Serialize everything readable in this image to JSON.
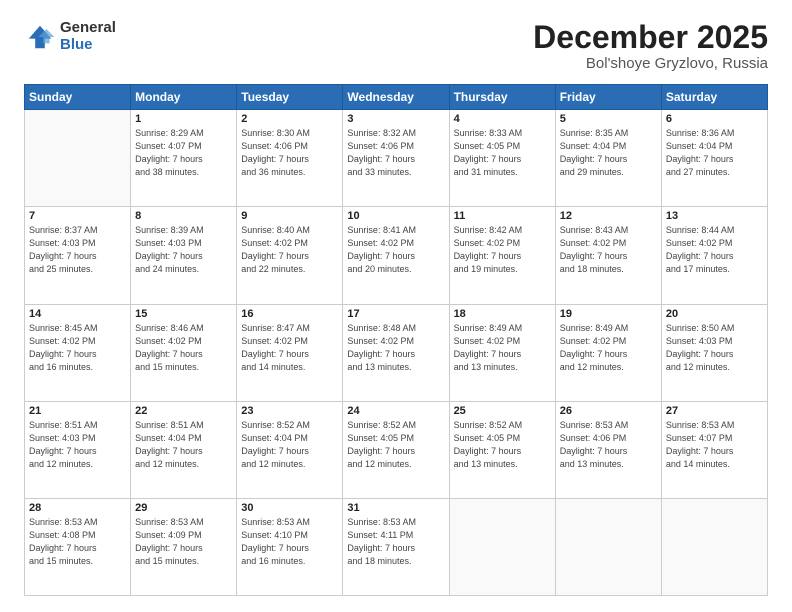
{
  "logo": {
    "general": "General",
    "blue": "Blue"
  },
  "header": {
    "month": "December 2025",
    "location": "Bol'shoye Gryzlovo, Russia"
  },
  "weekdays": [
    "Sunday",
    "Monday",
    "Tuesday",
    "Wednesday",
    "Thursday",
    "Friday",
    "Saturday"
  ],
  "weeks": [
    [
      {
        "day": "",
        "info": ""
      },
      {
        "day": "1",
        "info": "Sunrise: 8:29 AM\nSunset: 4:07 PM\nDaylight: 7 hours\nand 38 minutes."
      },
      {
        "day": "2",
        "info": "Sunrise: 8:30 AM\nSunset: 4:06 PM\nDaylight: 7 hours\nand 36 minutes."
      },
      {
        "day": "3",
        "info": "Sunrise: 8:32 AM\nSunset: 4:06 PM\nDaylight: 7 hours\nand 33 minutes."
      },
      {
        "day": "4",
        "info": "Sunrise: 8:33 AM\nSunset: 4:05 PM\nDaylight: 7 hours\nand 31 minutes."
      },
      {
        "day": "5",
        "info": "Sunrise: 8:35 AM\nSunset: 4:04 PM\nDaylight: 7 hours\nand 29 minutes."
      },
      {
        "day": "6",
        "info": "Sunrise: 8:36 AM\nSunset: 4:04 PM\nDaylight: 7 hours\nand 27 minutes."
      }
    ],
    [
      {
        "day": "7",
        "info": "Sunrise: 8:37 AM\nSunset: 4:03 PM\nDaylight: 7 hours\nand 25 minutes."
      },
      {
        "day": "8",
        "info": "Sunrise: 8:39 AM\nSunset: 4:03 PM\nDaylight: 7 hours\nand 24 minutes."
      },
      {
        "day": "9",
        "info": "Sunrise: 8:40 AM\nSunset: 4:02 PM\nDaylight: 7 hours\nand 22 minutes."
      },
      {
        "day": "10",
        "info": "Sunrise: 8:41 AM\nSunset: 4:02 PM\nDaylight: 7 hours\nand 20 minutes."
      },
      {
        "day": "11",
        "info": "Sunrise: 8:42 AM\nSunset: 4:02 PM\nDaylight: 7 hours\nand 19 minutes."
      },
      {
        "day": "12",
        "info": "Sunrise: 8:43 AM\nSunset: 4:02 PM\nDaylight: 7 hours\nand 18 minutes."
      },
      {
        "day": "13",
        "info": "Sunrise: 8:44 AM\nSunset: 4:02 PM\nDaylight: 7 hours\nand 17 minutes."
      }
    ],
    [
      {
        "day": "14",
        "info": "Sunrise: 8:45 AM\nSunset: 4:02 PM\nDaylight: 7 hours\nand 16 minutes."
      },
      {
        "day": "15",
        "info": "Sunrise: 8:46 AM\nSunset: 4:02 PM\nDaylight: 7 hours\nand 15 minutes."
      },
      {
        "day": "16",
        "info": "Sunrise: 8:47 AM\nSunset: 4:02 PM\nDaylight: 7 hours\nand 14 minutes."
      },
      {
        "day": "17",
        "info": "Sunrise: 8:48 AM\nSunset: 4:02 PM\nDaylight: 7 hours\nand 13 minutes."
      },
      {
        "day": "18",
        "info": "Sunrise: 8:49 AM\nSunset: 4:02 PM\nDaylight: 7 hours\nand 13 minutes."
      },
      {
        "day": "19",
        "info": "Sunrise: 8:49 AM\nSunset: 4:02 PM\nDaylight: 7 hours\nand 12 minutes."
      },
      {
        "day": "20",
        "info": "Sunrise: 8:50 AM\nSunset: 4:03 PM\nDaylight: 7 hours\nand 12 minutes."
      }
    ],
    [
      {
        "day": "21",
        "info": "Sunrise: 8:51 AM\nSunset: 4:03 PM\nDaylight: 7 hours\nand 12 minutes."
      },
      {
        "day": "22",
        "info": "Sunrise: 8:51 AM\nSunset: 4:04 PM\nDaylight: 7 hours\nand 12 minutes."
      },
      {
        "day": "23",
        "info": "Sunrise: 8:52 AM\nSunset: 4:04 PM\nDaylight: 7 hours\nand 12 minutes."
      },
      {
        "day": "24",
        "info": "Sunrise: 8:52 AM\nSunset: 4:05 PM\nDaylight: 7 hours\nand 12 minutes."
      },
      {
        "day": "25",
        "info": "Sunrise: 8:52 AM\nSunset: 4:05 PM\nDaylight: 7 hours\nand 13 minutes."
      },
      {
        "day": "26",
        "info": "Sunrise: 8:53 AM\nSunset: 4:06 PM\nDaylight: 7 hours\nand 13 minutes."
      },
      {
        "day": "27",
        "info": "Sunrise: 8:53 AM\nSunset: 4:07 PM\nDaylight: 7 hours\nand 14 minutes."
      }
    ],
    [
      {
        "day": "28",
        "info": "Sunrise: 8:53 AM\nSunset: 4:08 PM\nDaylight: 7 hours\nand 15 minutes."
      },
      {
        "day": "29",
        "info": "Sunrise: 8:53 AM\nSunset: 4:09 PM\nDaylight: 7 hours\nand 15 minutes."
      },
      {
        "day": "30",
        "info": "Sunrise: 8:53 AM\nSunset: 4:10 PM\nDaylight: 7 hours\nand 16 minutes."
      },
      {
        "day": "31",
        "info": "Sunrise: 8:53 AM\nSunset: 4:11 PM\nDaylight: 7 hours\nand 18 minutes."
      },
      {
        "day": "",
        "info": ""
      },
      {
        "day": "",
        "info": ""
      },
      {
        "day": "",
        "info": ""
      }
    ]
  ]
}
